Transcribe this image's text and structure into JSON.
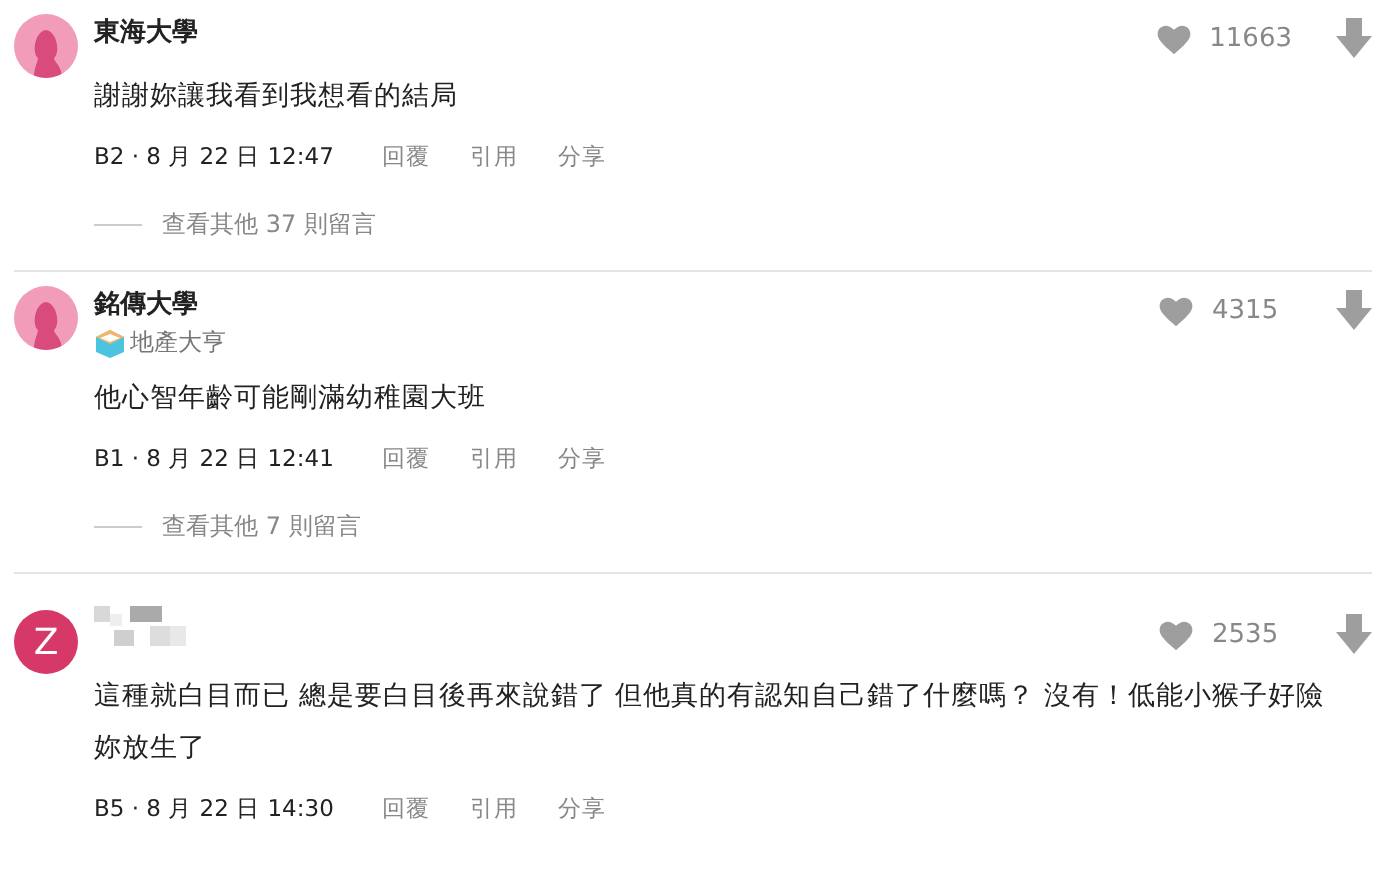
{
  "comments": [
    {
      "avatar": {
        "kind": "silhouette"
      },
      "author": "東海大學",
      "likes": "11663",
      "body": "謝謝妳讓我看到我想看的結局",
      "timestamp": "B2 · 8 月 22 日 12:47",
      "actions": [
        "回覆",
        "引用",
        "分享"
      ],
      "more_replies": "查看其他 37 則留言"
    },
    {
      "avatar": {
        "kind": "silhouette"
      },
      "author": "銘傳大學",
      "badge": "地產大亨",
      "likes": "4315",
      "body": "他心智年齡可能剛滿幼稚園大班",
      "timestamp": "B1 · 8 月 22 日 12:41",
      "actions": [
        "回覆",
        "引用",
        "分享"
      ],
      "more_replies": "查看其他 7 則留言"
    },
    {
      "avatar": {
        "kind": "letter",
        "letter": "Z",
        "color": "#d63868"
      },
      "author_hidden": true,
      "likes": "2535",
      "body": "這種就白目而已 總是要白目後再來說錯了 但他真的有認知自己錯了什麼嗎？ 沒有！低能小猴子好險妳放生了",
      "timestamp": "B5 · 8 月 22 日 14:30",
      "actions": [
        "回覆",
        "引用",
        "分享"
      ]
    }
  ]
}
